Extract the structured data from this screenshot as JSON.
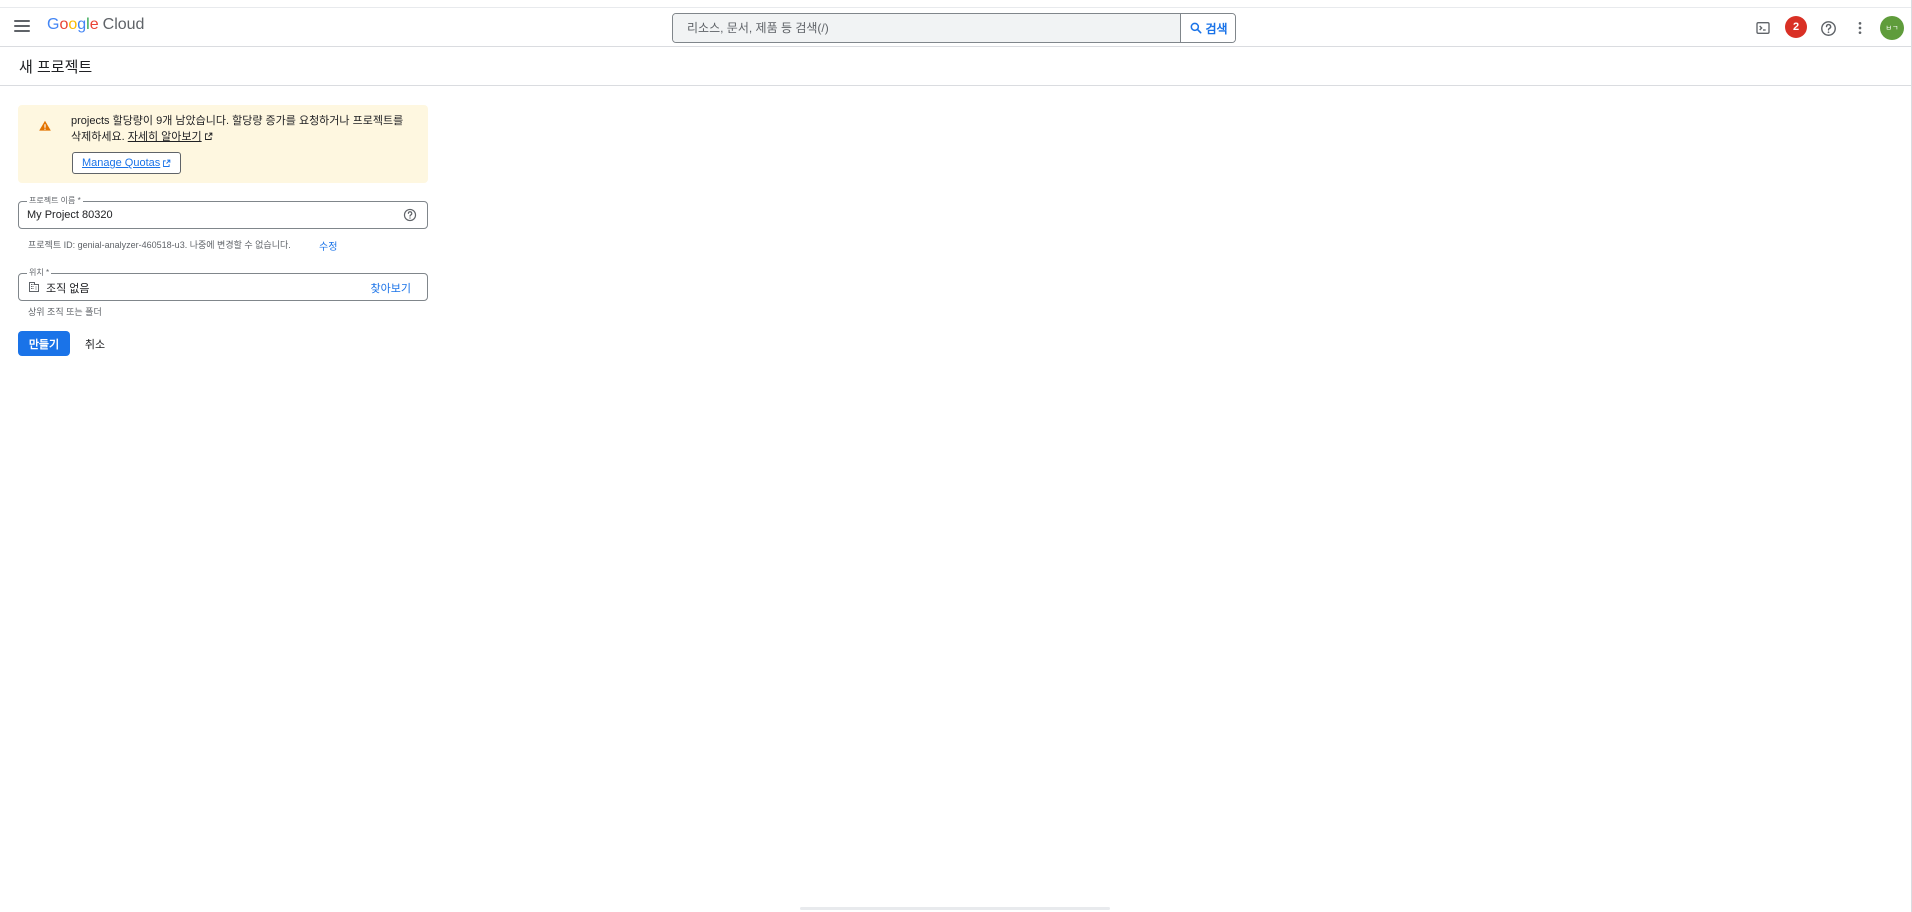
{
  "header": {
    "logo_google": [
      "G",
      "o",
      "o",
      "g",
      "l",
      "e"
    ],
    "logo_cloud": "Cloud",
    "search_placeholder": "리소스, 문서, 제품 등 검색(/)",
    "search_button_label": "검색",
    "notification_count": "2",
    "avatar_initials": "ㅂㄱ"
  },
  "page": {
    "title": "새 프로젝트"
  },
  "alert": {
    "line1": "projects 할당량이 9개 남았습니다. 할당량 증가를 요청하거나 프로젝트를",
    "line2_prefix": "삭제하세요. ",
    "learn_more": "자세히 알아보기",
    "manage_quotas": "Manage Quotas"
  },
  "form": {
    "project_name_label": "프로젝트 이름 *",
    "project_name_value": "My Project 80320",
    "project_id_hint": "프로젝트 ID: genial-analyzer-460518-u3. 나중에 변경할 수 없습니다.",
    "edit_label": "수정",
    "location_label": "위치 *",
    "location_value": "조직 없음",
    "browse_label": "찾아보기",
    "location_hint": "상위 조직 또는 폴더"
  },
  "actions": {
    "create": "만들기",
    "cancel": "취소"
  },
  "colors": {
    "accent": "#1a73e8",
    "alert_bg": "#fef7e0",
    "warning": "#e37400",
    "badge": "#d93025"
  }
}
